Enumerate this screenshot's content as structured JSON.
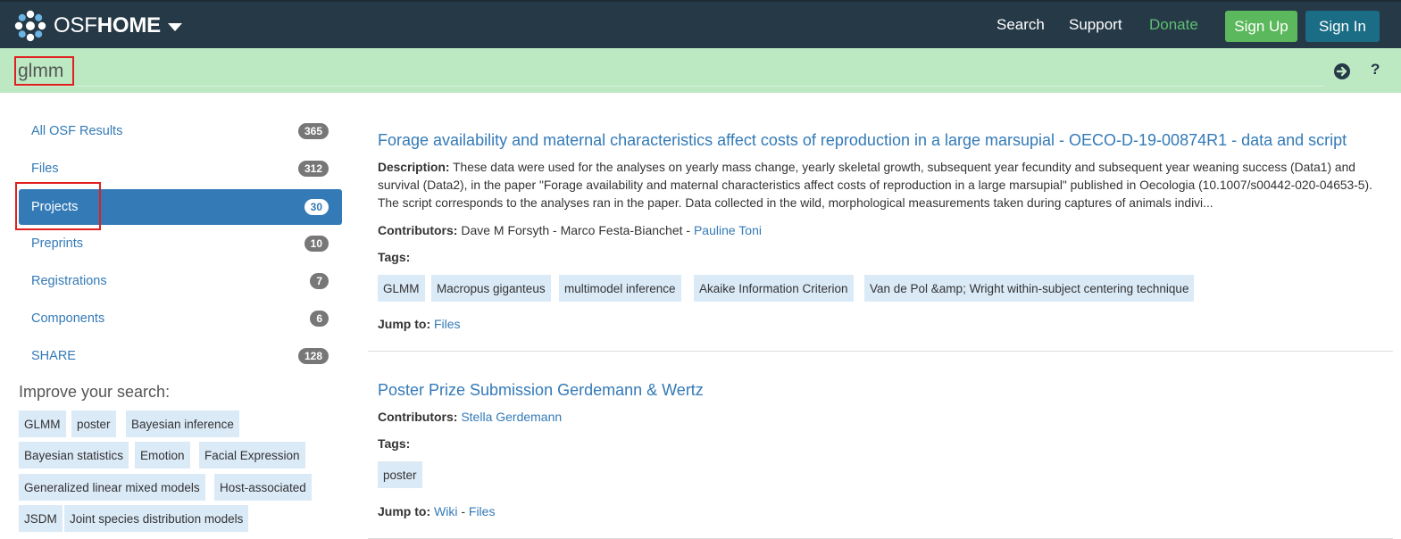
{
  "navbar": {
    "brand_light": "OSF",
    "brand_bold": "HOME",
    "links": {
      "search": "Search",
      "support": "Support",
      "donate": "Donate"
    },
    "sign_up": "Sign Up",
    "sign_in": "Sign In",
    "donate_color": "#5fbf72"
  },
  "search": {
    "value": "glmm"
  },
  "sidebar": {
    "items": [
      {
        "label": "All OSF Results",
        "count": "365"
      },
      {
        "label": "Files",
        "count": "312"
      },
      {
        "label": "Projects",
        "count": "30",
        "active": true
      },
      {
        "label": "Preprints",
        "count": "10"
      },
      {
        "label": "Registrations",
        "count": "7"
      },
      {
        "label": "Components",
        "count": "6"
      },
      {
        "label": "SHARE",
        "count": "128"
      }
    ],
    "improve_heading": "Improve your search:",
    "tags": [
      "GLMM",
      "poster",
      "Bayesian inference",
      "Bayesian statistics",
      "Emotion",
      "Facial Expression",
      "Generalized linear mixed models",
      "Host-associated",
      "JSDM",
      "Joint species distribution models"
    ]
  },
  "results": [
    {
      "title": "Forage availability and maternal characteristics affect costs of reproduction in a large marsupial - OECO-D-19-00874R1 - data and script",
      "description_label": "Description:",
      "description": "These data were used for the analyses on yearly mass change, yearly skeletal growth, subsequent year fecundity and subsequent year weaning success (Data1) and survival (Data2), in the paper \"Forage availability and maternal characteristics affect costs of reproduction in a large marsupial\" published in Oecologia (10.1007/s00442-020-04653-5). The script corresponds to the analyses ran in the paper. Data collected in the wild, morphological measurements taken during captures of animals indivi...",
      "contributors_label": "Contributors:",
      "contributors_plain": "Dave M Forsyth  - Marco Festa-Bianchet  - ",
      "contributors_link": "Pauline Toni",
      "tags_label": "Tags:",
      "tags": [
        "GLMM",
        "Macropus giganteus",
        "multimodel inference",
        "Akaike Information Criterion",
        "Van de Pol &amp; Wright within-subject centering technique"
      ],
      "jump_label": "Jump to:",
      "jump_links": [
        "Files"
      ]
    },
    {
      "title": "Poster Prize Submission Gerdemann & Wertz",
      "contributors_label": "Contributors:",
      "contributors_link": "Stella Gerdemann",
      "tags_label": "Tags:",
      "tags": [
        "poster"
      ],
      "jump_label": "Jump to:",
      "jump_links": [
        "Wiki",
        "Files"
      ],
      "jump_sep": " - "
    }
  ]
}
